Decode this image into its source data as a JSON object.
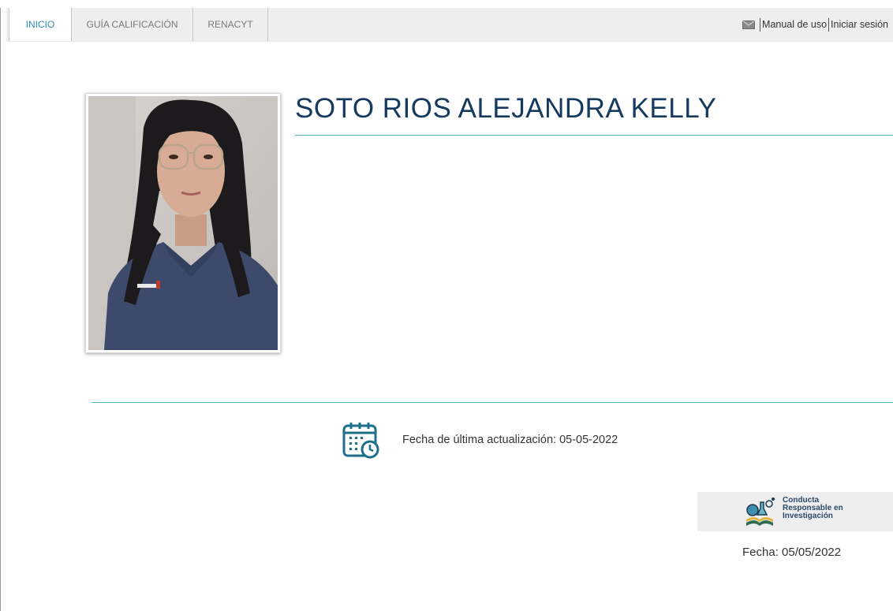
{
  "nav": {
    "tabs": [
      {
        "label": "INICIO",
        "active": true
      },
      {
        "label": "GUÍA CALIFICACIÓN",
        "active": false
      },
      {
        "label": "RENACYT",
        "active": false
      }
    ],
    "manual_label": "Manual de uso",
    "login_label": "Iniciar sesión",
    "mail_icon": "envelope-icon"
  },
  "profile": {
    "name": "SOTO RIOS ALEJANDRA KELLY",
    "photo_icon": "profile-photo"
  },
  "update": {
    "label": "Fecha de última actualización: 05-05-2022",
    "icon": "calendar-clock-icon"
  },
  "cri": {
    "line1": "Conducta",
    "line2": "Responsable en",
    "line3": "Investigación",
    "date_text": "Fecha:  05/05/2022"
  },
  "colors": {
    "accent": "#2c8fae",
    "name": "#163a5f",
    "rule": "#5bb3c7"
  }
}
